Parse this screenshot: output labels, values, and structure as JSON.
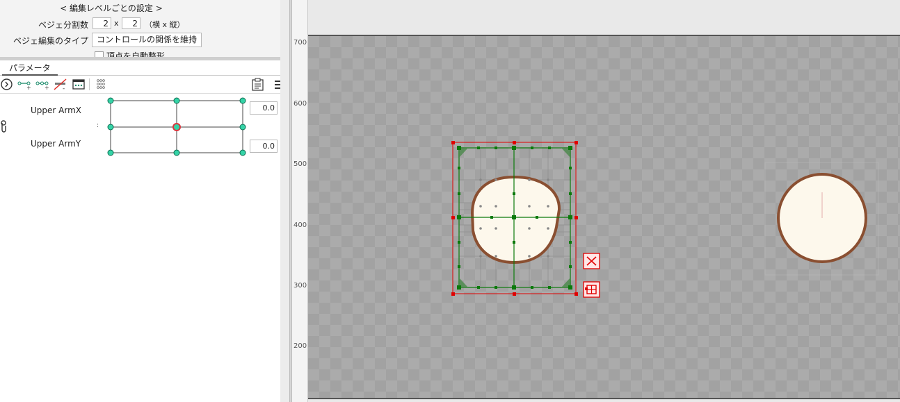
{
  "settings": {
    "title": "< 編集レベルごとの設定 >",
    "bezier_divisions_label": "ベジェ分割数",
    "div_h": "2",
    "x_sep": "x",
    "div_v": "2",
    "div_suffix": "（横 x 縦）",
    "bezier_type_label": "ベジェ編集のタイプ",
    "bezier_type_value": "コントロールの関係を維持",
    "auto_deform_label": "頂点を自動整形"
  },
  "tabs": [
    {
      "label": "パラメータ"
    }
  ],
  "parameters": [
    {
      "name": "Upper ArmX",
      "value": "0.0"
    },
    {
      "name": "Upper ArmY",
      "value": "0.0"
    }
  ],
  "param_separator": ":",
  "ruler": {
    "ticks": [
      "700",
      "600",
      "500",
      "400",
      "300",
      "200"
    ]
  },
  "icons": {
    "toolbar": [
      "expand-icon",
      "add-key-icon",
      "add-keys-icon",
      "remove-key-icon",
      "grid-view-icon",
      "keyform-dots-icon",
      "paste-icon",
      "menu-icon"
    ],
    "canvas": [
      "close-x-icon",
      "warp-grid-icon"
    ]
  },
  "colors": {
    "accent_green": "#1aa86a",
    "node_fill": "#35d3a7",
    "selected_node": "#d9363e",
    "bbox_red": "#e00000",
    "mesh_green": "#0b7a0b",
    "skin": "#fdf8ec",
    "outline_brown": "#8a4f31"
  }
}
